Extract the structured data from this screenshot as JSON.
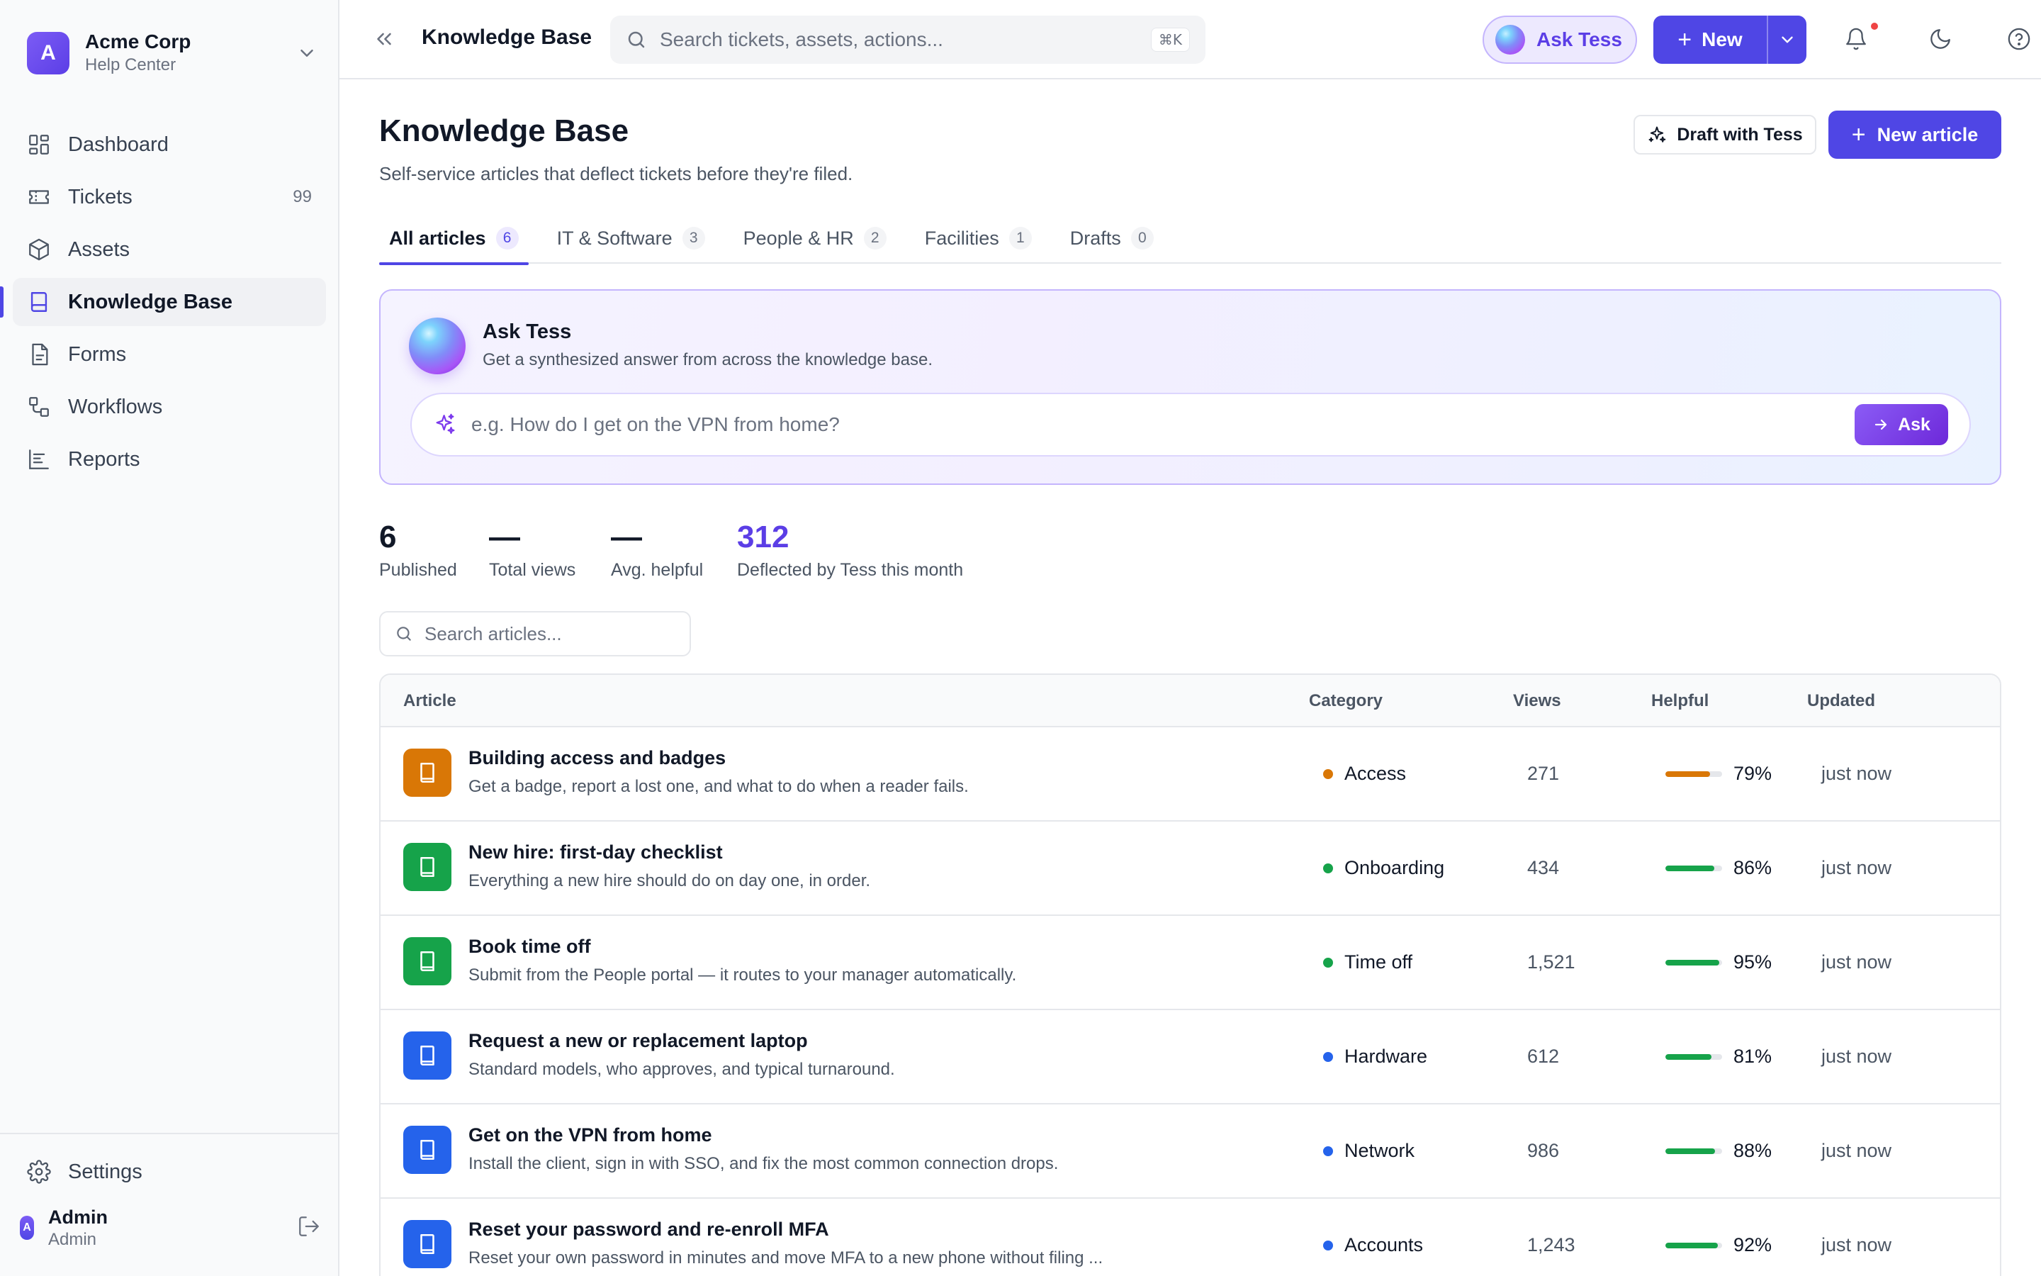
{
  "org": {
    "initial": "A",
    "name": "Acme Corp",
    "subtitle": "Help Center"
  },
  "sidebar": {
    "items": [
      {
        "label": "Dashboard",
        "icon": "dashboard-icon",
        "count": ""
      },
      {
        "label": "Tickets",
        "icon": "ticket-icon",
        "count": "99"
      },
      {
        "label": "Assets",
        "icon": "box-icon",
        "count": ""
      },
      {
        "label": "Knowledge Base",
        "icon": "book-icon",
        "count": "",
        "active": true
      },
      {
        "label": "Forms",
        "icon": "form-icon",
        "count": ""
      },
      {
        "label": "Workflows",
        "icon": "workflow-icon",
        "count": ""
      },
      {
        "label": "Reports",
        "icon": "report-icon",
        "count": ""
      }
    ],
    "settings_label": "Settings",
    "user": {
      "initial": "A",
      "name": "Admin",
      "role": "Admin"
    }
  },
  "topbar": {
    "title": "Knowledge Base",
    "search_placeholder": "Search tickets, assets, actions...",
    "search_shortcut": "⌘K",
    "ask_tess_label": "Ask Tess",
    "new_label": "New"
  },
  "page": {
    "title": "Knowledge Base",
    "subtitle": "Self-service articles that deflect tickets before they're filed.",
    "draft_label": "Draft with Tess",
    "new_article_label": "New article"
  },
  "tabs": [
    {
      "label": "All articles",
      "count": "6",
      "active": true
    },
    {
      "label": "IT & Software",
      "count": "3"
    },
    {
      "label": "People & HR",
      "count": "2"
    },
    {
      "label": "Facilities",
      "count": "1"
    },
    {
      "label": "Drafts",
      "count": "0"
    }
  ],
  "ask_panel": {
    "title": "Ask Tess",
    "subtitle": "Get a synthesized answer from across the knowledge base.",
    "placeholder": "e.g. How do I get on the VPN from home?",
    "button_label": "Ask"
  },
  "stats": [
    {
      "value": "6",
      "label": "Published"
    },
    {
      "value": "—",
      "label": "Total views"
    },
    {
      "value": "—",
      "label": "Avg. helpful"
    },
    {
      "value": "312",
      "label": "Deflected by Tess this month"
    }
  ],
  "article_search_placeholder": "Search articles...",
  "table": {
    "headers": {
      "article": "Article",
      "category": "Category",
      "views": "Views",
      "helpful": "Helpful",
      "updated": "Updated"
    },
    "rows": [
      {
        "title": "Building access and badges",
        "description": "Get a badge, report a lost one, and what to do when a reader fails.",
        "category": "Access",
        "category_color": "#d97706",
        "icon_color": "#d97706",
        "views": "271",
        "helpful_label": "79%",
        "helpful": 0.79,
        "bar_color": "#d97706",
        "updated": "just now"
      },
      {
        "title": "New hire: first-day checklist",
        "description": "Everything a new hire should do on day one, in order.",
        "category": "Onboarding",
        "category_color": "#16a34a",
        "icon_color": "#16a34a",
        "views": "434",
        "helpful_label": "86%",
        "helpful": 0.86,
        "bar_color": "#16a34a",
        "updated": "just now"
      },
      {
        "title": "Book time off",
        "description": "Submit from the People portal — it routes to your manager automatically.",
        "category": "Time off",
        "category_color": "#16a34a",
        "icon_color": "#16a34a",
        "views": "1,521",
        "helpful_label": "95%",
        "helpful": 0.95,
        "bar_color": "#16a34a",
        "updated": "just now"
      },
      {
        "title": "Request a new or replacement laptop",
        "description": "Standard models, who approves, and typical turnaround.",
        "category": "Hardware",
        "category_color": "#2563eb",
        "icon_color": "#2563eb",
        "views": "612",
        "helpful_label": "81%",
        "helpful": 0.81,
        "bar_color": "#16a34a",
        "updated": "just now"
      },
      {
        "title": "Get on the VPN from home",
        "description": "Install the client, sign in with SSO, and fix the most common connection drops.",
        "category": "Network",
        "category_color": "#2563eb",
        "icon_color": "#2563eb",
        "views": "986",
        "helpful_label": "88%",
        "helpful": 0.88,
        "bar_color": "#16a34a",
        "updated": "just now"
      },
      {
        "title": "Reset your password and re-enroll MFA",
        "description": "Reset your own password in minutes and move MFA to a new phone without filing ...",
        "category": "Accounts",
        "category_color": "#2563eb",
        "icon_color": "#2563eb",
        "views": "1,243",
        "helpful_label": "92%",
        "helpful": 0.92,
        "bar_color": "#16a34a",
        "updated": "just now"
      }
    ]
  },
  "colors": {
    "accent": "#4f46e5",
    "accent_text": "#5b3ee6",
    "notification": "#ef4444"
  }
}
